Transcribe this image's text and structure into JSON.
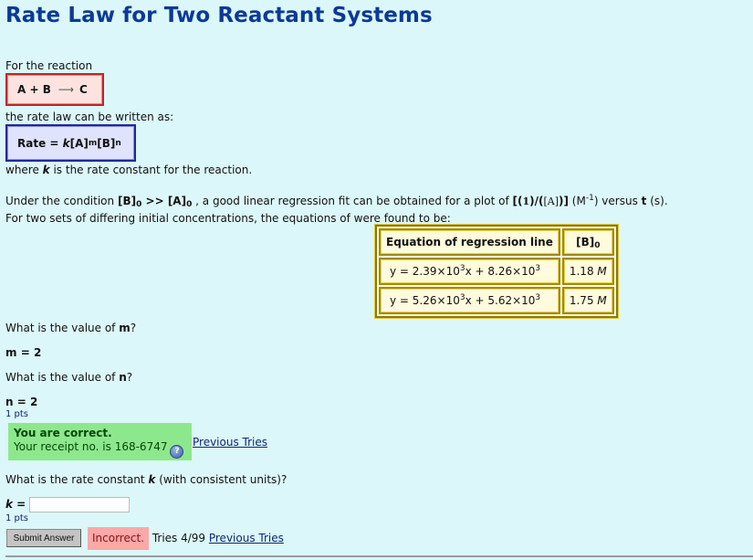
{
  "page": {
    "title": "Rate Law for Two Reactant Systems"
  },
  "intro": {
    "for_reaction": "For the reaction",
    "reaction": {
      "reactants": "A + B",
      "arrow": "⟶",
      "product": "C"
    },
    "rate_law_intro": "the rate law can be written as:",
    "rate_law": {
      "prefix": "Rate = ",
      "k": "k",
      "a": "[A]",
      "m": "m",
      "b": "[B]",
      "n": "n"
    },
    "where_pre": "where ",
    "where_k": "k",
    "where_post": " is the rate constant for the reaction."
  },
  "condition": {
    "pre": "Under the condition ",
    "b0": "[B]",
    "gt": " >> ",
    "a0": "[A]",
    "sub0": "0",
    "mid": " , a good linear regression fit can be obtained for a plot of ",
    "plot_expr_open": "[(",
    "plot_one": "1",
    "plot_mid": ")/(",
    "plot_a": "[A]",
    "plot_close": ")]",
    "units_open": " (M",
    "units_exp": "-1",
    "units_close": ") versus ",
    "t": "t",
    "t_units": " (s).",
    "line2": "For two sets of differing initial concentrations, the equations of were found to be:"
  },
  "table": {
    "headers": {
      "equation": "Equation of regression line",
      "b0": "[B]",
      "b0_sub": "0"
    },
    "rows": [
      {
        "slope": "2.39",
        "intercept": "8.26",
        "exp": "3",
        "conc": "1.18",
        "unit": "M"
      },
      {
        "slope": "5.26",
        "intercept": "5.62",
        "exp": "3",
        "conc": "1.75",
        "unit": "M"
      }
    ]
  },
  "questions": {
    "q1": {
      "pre": "What is the value of ",
      "var": "m",
      "post": "?",
      "answer_label": "m",
      "eq": " = ",
      "answer": "2"
    },
    "q2": {
      "pre": "What is the value of ",
      "var": "n",
      "post": "?",
      "answer_label": "n",
      "eq": " = ",
      "answer": "2",
      "pts": "1 pts"
    },
    "feedback_correct": {
      "heading": "You are correct.",
      "receipt": "Your receipt no. is 168-6747",
      "help_glyph": "?",
      "previous_tries": "Previous Tries"
    },
    "q3": {
      "pre": "What is the rate constant ",
      "var": "k",
      "post": " (with consistent units)?",
      "answer_label": "k",
      "eq": " =",
      "answer_value": "",
      "pts": "1 pts",
      "submit": "Submit Answer",
      "incorrect": "Incorrect.",
      "tries": " Tries 4/99 ",
      "previous_tries": "Previous Tries"
    }
  }
}
